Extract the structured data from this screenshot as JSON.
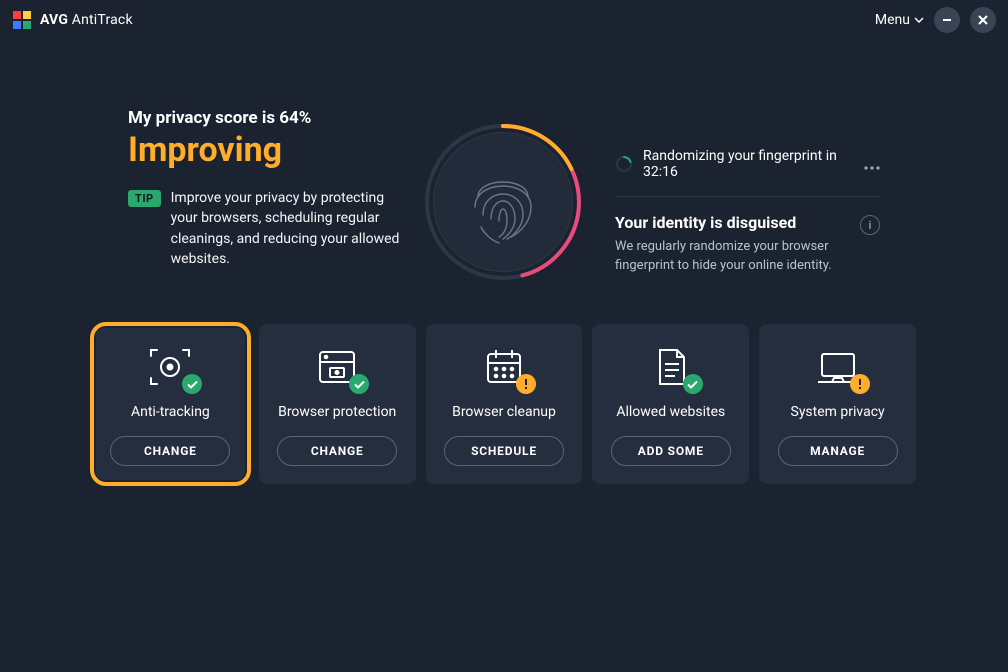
{
  "app": {
    "brand": "AVG",
    "name": "AntiTrack",
    "menu_label": "Menu"
  },
  "hero": {
    "score_line": "My privacy score is 64%",
    "status": "Improving",
    "tip_badge": "TIP",
    "tip_text": "Improve your privacy by protecting your browsers, scheduling regular cleanings, and reducing your allowed websites.",
    "countdown_text": "Randomizing your fingerprint in 32:16",
    "identity_title": "Your identity is disguised",
    "identity_desc": "We regularly randomize your browser fingerprint to hide your online identity."
  },
  "tiles": [
    {
      "id": "anti-tracking",
      "title": "Anti-tracking",
      "button": "CHANGE",
      "badge": "ok",
      "highlighted": true
    },
    {
      "id": "browser-protection",
      "title": "Browser protection",
      "button": "CHANGE",
      "badge": "ok",
      "highlighted": false
    },
    {
      "id": "browser-cleanup",
      "title": "Browser cleanup",
      "button": "SCHEDULE",
      "badge": "warn",
      "highlighted": false
    },
    {
      "id": "allowed-websites",
      "title": "Allowed websites",
      "button": "ADD SOME",
      "badge": "ok",
      "highlighted": false
    },
    {
      "id": "system-privacy",
      "title": "System privacy",
      "button": "MANAGE",
      "badge": "warn",
      "highlighted": false
    }
  ]
}
